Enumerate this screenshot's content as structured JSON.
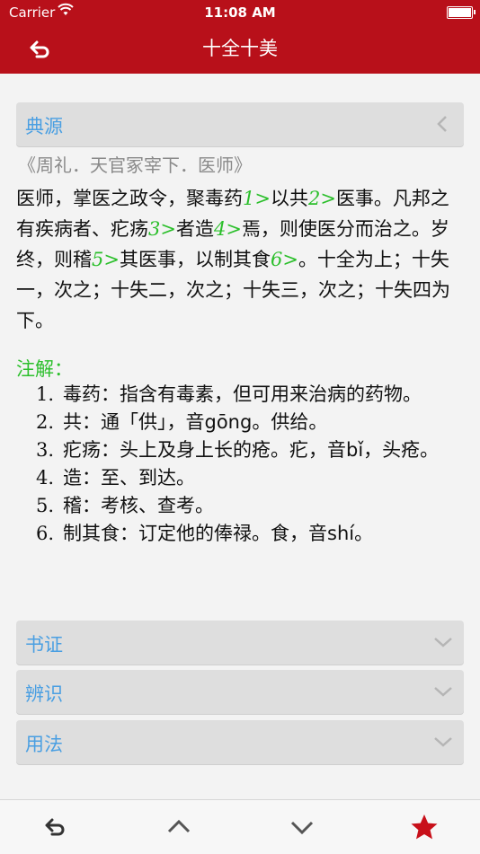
{
  "status_bar": {
    "carrier": "Carrier",
    "time": "11:08 AM"
  },
  "nav": {
    "title": "十全十美"
  },
  "sections": {
    "source": {
      "label": "典源"
    },
    "book": {
      "label": "书证"
    },
    "distinguish": {
      "label": "辨识"
    },
    "usage": {
      "label": "用法"
    }
  },
  "source_ref": "《周礼．天官冢宰下．医师》",
  "body": {
    "p1": "医师，掌医之政令，聚毒药",
    "r1": "1>",
    "p2": "以共",
    "r2": "2>",
    "p3": "医事。凡邦之有疾病者、疕疡",
    "r3": "3>",
    "p4": "者造",
    "r4": "4>",
    "p5": "焉，则使医分而治之。岁终，则稽",
    "r5": "5>",
    "p6": "其医事，以制其食",
    "r6": "6>",
    "p7": "。十全为上；十失一，次之；十失二，次之；十失三，次之；十失四为下。"
  },
  "notes_title": "注解：",
  "notes": [
    {
      "num": "1.",
      "text": "毒药：指含有毒素，但可用来治病的药物。"
    },
    {
      "num": "2.",
      "text": "共：通「供」，音gōng。供给。"
    },
    {
      "num": "3.",
      "text": "疕疡：头上及身上长的疮。疕，音bǐ，头疮。"
    },
    {
      "num": "4.",
      "text": "造：至、到达。"
    },
    {
      "num": "5.",
      "text": "稽：考核、查考。"
    },
    {
      "num": "6.",
      "text": "制其食：订定他的俸禄。食，音shí。"
    }
  ],
  "colors": {
    "accent": "#b8101a",
    "link_blue": "#4a9fe2",
    "note_green": "#2bbf2b"
  }
}
